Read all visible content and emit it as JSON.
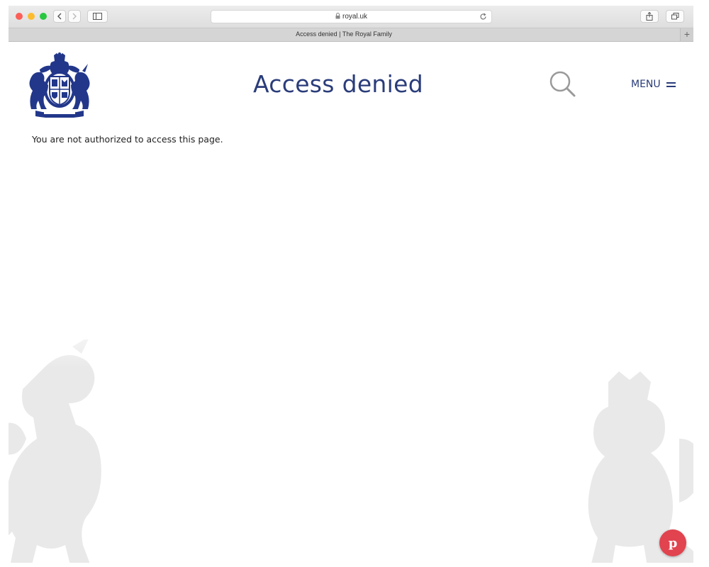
{
  "browser": {
    "url": "royal.uk",
    "tab_title": "Access denied | The Royal Family",
    "new_tab_label": "+"
  },
  "header": {
    "logo": "royal-coat-of-arms",
    "title": "Access denied",
    "menu_label": "MENU"
  },
  "main": {
    "message": "You are not authorized to access this page."
  },
  "floating": {
    "pinterest_label": "p"
  },
  "colors": {
    "brand": "#2a3c7a",
    "pinterest": "#e1434f"
  },
  "icons": [
    "search-icon",
    "hamburger-icon",
    "lock-icon",
    "reload-icon",
    "share-icon",
    "tabs-icon",
    "sidebar-icon",
    "back-icon",
    "forward-icon"
  ]
}
